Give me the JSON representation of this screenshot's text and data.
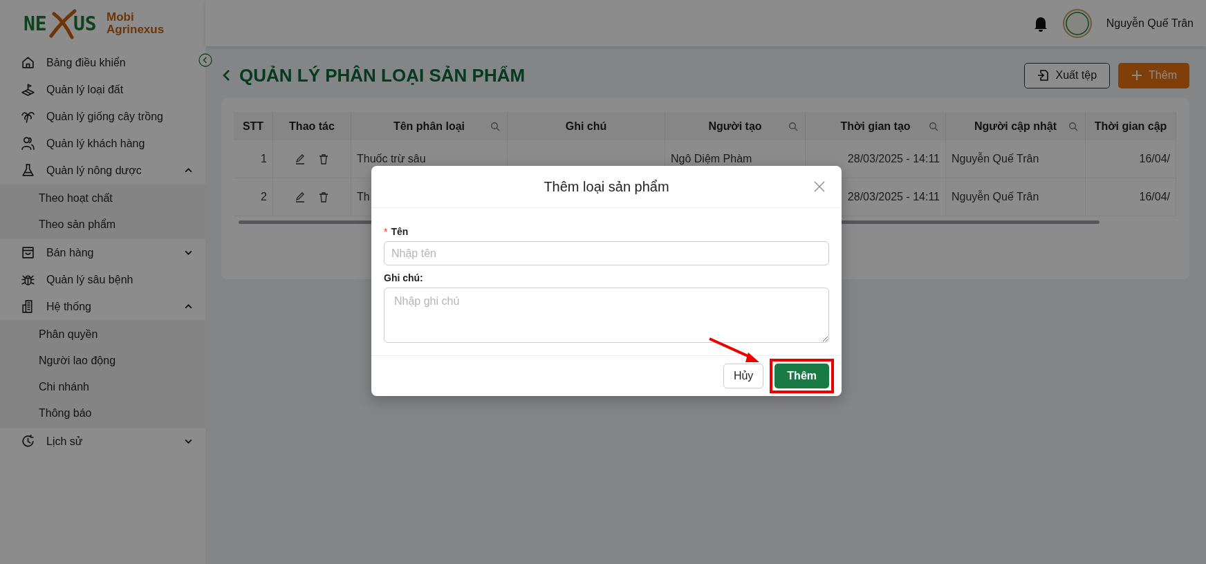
{
  "logo": {
    "mark_left": "NE",
    "mark_right": "US",
    "line_1": "Mobi",
    "line_2": "Agrinexus"
  },
  "user": {
    "name": "Nguyễn Quế Trân"
  },
  "sidebar": {
    "items": [
      {
        "label": "Bảng điều khiển"
      },
      {
        "label": "Quản lý loại đất"
      },
      {
        "label": "Quản lý giống cây trồng"
      },
      {
        "label": "Quản lý khách hàng"
      },
      {
        "label": "Quản lý nông dược",
        "expanded": true,
        "children": [
          {
            "label": "Theo hoạt chất"
          },
          {
            "label": "Theo sản phẩm"
          }
        ]
      },
      {
        "label": "Bán hàng",
        "expanded": false
      },
      {
        "label": "Quản lý sâu bệnh"
      },
      {
        "label": "Hệ thống",
        "expanded": true,
        "children": [
          {
            "label": "Phân quyền"
          },
          {
            "label": "Người lao động"
          },
          {
            "label": "Chi nhánh"
          },
          {
            "label": "Thông báo"
          }
        ]
      },
      {
        "label": "Lịch sử",
        "expanded": false
      }
    ]
  },
  "page": {
    "title": "QUẢN LÝ PHÂN LOẠI SẢN PHẨM",
    "buttons": [
      {
        "kind": "outline",
        "label": "Xuất tệp"
      },
      {
        "kind": "primary",
        "label": "Thêm"
      }
    ]
  },
  "table": {
    "columns": [
      {
        "label": "STT",
        "searchable": false
      },
      {
        "label": "Thao tác",
        "searchable": false
      },
      {
        "label": "Tên phân loại",
        "searchable": true
      },
      {
        "label": "Ghi chú",
        "searchable": false
      },
      {
        "label": "Người tạo",
        "searchable": true
      },
      {
        "label": "Thời gian tạo",
        "searchable": true
      },
      {
        "label": "Người cập nhật",
        "searchable": true
      },
      {
        "label": "Thời gian cập",
        "searchable": false
      }
    ],
    "rows": [
      [
        "1",
        "",
        "Thuốc trừ sâu",
        "",
        "Ngô Diệm Phàm",
        "28/03/2025 - 14:11",
        "Nguyễn Quế Trân",
        "16/04/"
      ],
      [
        "2",
        "",
        "Th",
        "",
        "",
        "28/03/2025 - 14:11",
        "Nguyễn Quế Trân",
        "16/04/"
      ]
    ]
  },
  "modal": {
    "title": "Thêm loại sản phẩm",
    "fields": [
      {
        "kind": "input",
        "marker": "*",
        "label": "Tên",
        "placeholder": "Nhập tên"
      },
      {
        "kind": "textarea",
        "label": "Ghi chú:",
        "placeholder": "Nhập ghi chú"
      }
    ],
    "buttons": [
      {
        "kind": "default",
        "label": "Hủy",
        "highlighted": false
      },
      {
        "kind": "primary",
        "label": "Thêm",
        "highlighted": true
      }
    ]
  }
}
